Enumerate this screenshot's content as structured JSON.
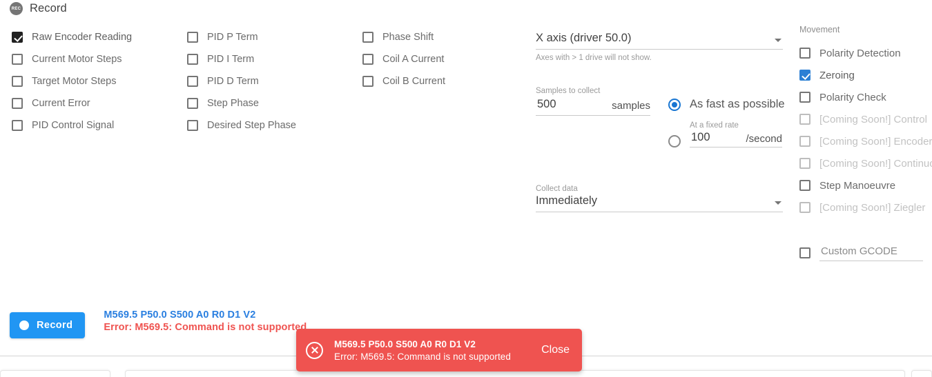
{
  "header": {
    "title": "Record",
    "icon": "record-icon",
    "icon_text": "REC"
  },
  "signals": {
    "column1": [
      {
        "label": "Raw Encoder Reading",
        "checked": true,
        "style": "dark",
        "disabled": false
      },
      {
        "label": "Current Motor Steps",
        "checked": false,
        "style": "outline",
        "disabled": false
      },
      {
        "label": "Target Motor Steps",
        "checked": false,
        "style": "outline",
        "disabled": false
      },
      {
        "label": "Current Error",
        "checked": false,
        "style": "outline",
        "disabled": false
      },
      {
        "label": "PID Control Signal",
        "checked": false,
        "style": "outline",
        "disabled": false
      }
    ],
    "column2": [
      {
        "label": "PID P Term",
        "checked": false,
        "style": "outline",
        "disabled": false
      },
      {
        "label": "PID I Term",
        "checked": false,
        "style": "outline",
        "disabled": false
      },
      {
        "label": "PID D Term",
        "checked": false,
        "style": "outline",
        "disabled": false
      },
      {
        "label": "Step Phase",
        "checked": false,
        "style": "outline",
        "disabled": false
      },
      {
        "label": "Desired Step Phase",
        "checked": false,
        "style": "outline",
        "disabled": false
      }
    ],
    "column3": [
      {
        "label": "Phase Shift",
        "checked": false,
        "style": "outline",
        "disabled": false
      },
      {
        "label": "Coil A Current",
        "checked": false,
        "style": "outline",
        "disabled": false
      },
      {
        "label": "Coil B Current",
        "checked": false,
        "style": "outline",
        "disabled": false
      }
    ]
  },
  "form": {
    "axis_select": {
      "value": "X axis (driver 50.0)",
      "helper": "Axes with > 1 drive will not show."
    },
    "samples": {
      "label": "Samples to collect",
      "value": "500",
      "suffix": "samples"
    },
    "rate_mode": {
      "fast_label": "As fast as possible",
      "fast_selected": true,
      "fixed_label": "At a fixed rate",
      "fixed_value": "100",
      "fixed_suffix": "/second",
      "fixed_selected": false
    },
    "collect_data": {
      "label": "Collect data",
      "value": "Immediately"
    }
  },
  "movement": {
    "title": "Movement",
    "items": [
      {
        "label": "Polarity Detection",
        "checked": false,
        "style": "outline",
        "disabled": false
      },
      {
        "label": "Zeroing",
        "checked": true,
        "style": "blue",
        "disabled": false
      },
      {
        "label": "Polarity Check",
        "checked": false,
        "style": "outline",
        "disabled": false
      },
      {
        "label": "[Coming Soon!] Control",
        "checked": false,
        "style": "outline",
        "disabled": true
      },
      {
        "label": "[Coming Soon!] Encoder",
        "checked": false,
        "style": "outline",
        "disabled": true
      },
      {
        "label": "[Coming Soon!] Continuous",
        "checked": false,
        "style": "outline",
        "disabled": true
      },
      {
        "label": "Step Manoeuvre",
        "checked": false,
        "style": "outline",
        "disabled": false
      },
      {
        "label": "[Coming Soon!] Ziegler",
        "checked": false,
        "style": "outline",
        "disabled": true
      }
    ],
    "gcode": {
      "checked": false,
      "placeholder": "Custom GCODE",
      "value": ""
    }
  },
  "bottom": {
    "record_button": "Record",
    "command_sent": "M569.5 P50.0 S500 A0 R0 D1 V2",
    "command_error": "Error: M569.5: Command is not supported"
  },
  "toast": {
    "line1": "M569.5 P50.0 S500 A0 R0 D1 V2",
    "line2": "Error: M569.5: Command is not supported",
    "close_label": "Close",
    "color": "#ef5350"
  },
  "colors": {
    "accent_blue": "#2196f3",
    "checkbox_blue": "#2b7fd4",
    "error_red": "#ef5350",
    "command_blue": "#2a7fe0"
  }
}
